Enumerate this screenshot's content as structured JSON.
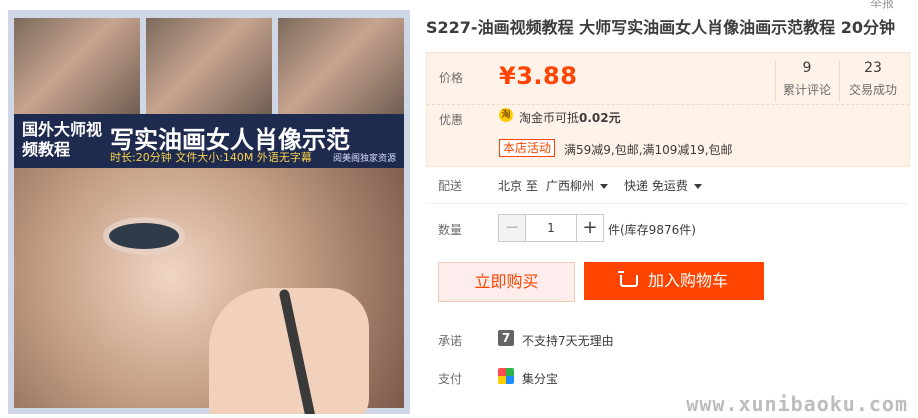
{
  "product": {
    "title": "S227-油画视频教程 大师写实油画女人肖像油画示范教程 20分钟",
    "top_right_cut": "举报",
    "image": {
      "left_title": "国外大师视频教程",
      "main_title": "写实油画女人肖像示范",
      "subline": "时长:20分钟   文件大小:140M   外语无字幕",
      "tag": "阅美阁独家资源"
    }
  },
  "price_panel": {
    "price_label": "价格",
    "price": "¥3.88",
    "reviews_count": "9",
    "reviews_label": "累计评论",
    "sales_count": "23",
    "sales_label": "交易成功",
    "discount_label": "优惠",
    "coin_icon": "淘",
    "coin_text": "淘金币可抵",
    "coin_amount": "0.02元",
    "activity_badge": "本店活动",
    "activity_text": "满59减9,包邮,满109减19,包邮"
  },
  "shipping": {
    "label": "配送",
    "from": "北京 至",
    "to": "广西柳州",
    "method": "快递 免运费"
  },
  "quantity": {
    "label": "数量",
    "value": "1",
    "stock": "件(库存9876件)"
  },
  "actions": {
    "buy_now": "立即购买",
    "add_to_cart": "加入购物车"
  },
  "promise": {
    "label": "承诺",
    "icon": "7",
    "text": "不支持7天无理由"
  },
  "payment": {
    "label": "支付",
    "text": "集分宝"
  },
  "watermark": "www.xunibaoku.com",
  "icons": {
    "minus": "−",
    "plus": "+"
  }
}
